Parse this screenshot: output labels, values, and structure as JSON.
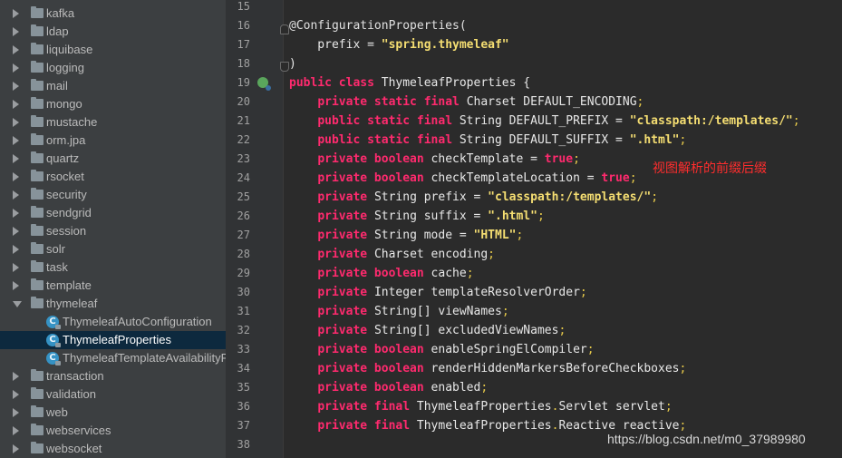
{
  "tree": {
    "items": [
      {
        "label": "kafka",
        "type": "folder",
        "expanded": false
      },
      {
        "label": "ldap",
        "type": "folder",
        "expanded": false
      },
      {
        "label": "liquibase",
        "type": "folder",
        "expanded": false
      },
      {
        "label": "logging",
        "type": "folder",
        "expanded": false
      },
      {
        "label": "mail",
        "type": "folder",
        "expanded": false
      },
      {
        "label": "mongo",
        "type": "folder",
        "expanded": false
      },
      {
        "label": "mustache",
        "type": "folder",
        "expanded": false
      },
      {
        "label": "orm.jpa",
        "type": "folder",
        "expanded": false
      },
      {
        "label": "quartz",
        "type": "folder",
        "expanded": false
      },
      {
        "label": "rsocket",
        "type": "folder",
        "expanded": false
      },
      {
        "label": "security",
        "type": "folder",
        "expanded": false
      },
      {
        "label": "sendgrid",
        "type": "folder",
        "expanded": false
      },
      {
        "label": "session",
        "type": "folder",
        "expanded": false
      },
      {
        "label": "solr",
        "type": "folder",
        "expanded": false
      },
      {
        "label": "task",
        "type": "folder",
        "expanded": false
      },
      {
        "label": "template",
        "type": "folder",
        "expanded": false
      },
      {
        "label": "thymeleaf",
        "type": "folder",
        "expanded": true
      },
      {
        "label": "ThymeleafAutoConfiguration",
        "type": "class",
        "icon_letter": "C"
      },
      {
        "label": "ThymeleafProperties",
        "type": "class",
        "icon_letter": "C",
        "selected": true
      },
      {
        "label": "ThymeleafTemplateAvailabilityProvider",
        "type": "class",
        "icon_letter": "C"
      },
      {
        "label": "transaction",
        "type": "folder",
        "expanded": false
      },
      {
        "label": "validation",
        "type": "folder",
        "expanded": false
      },
      {
        "label": "web",
        "type": "folder",
        "expanded": false
      },
      {
        "label": "webservices",
        "type": "folder",
        "expanded": false
      },
      {
        "label": "websocket",
        "type": "folder",
        "expanded": false
      }
    ]
  },
  "editor": {
    "line_numbers": [
      "15",
      "16",
      "17",
      "18",
      "19",
      "20",
      "21",
      "22",
      "23",
      "24",
      "25",
      "26",
      "27",
      "28",
      "29",
      "30",
      "31",
      "32",
      "33",
      "34",
      "35",
      "36",
      "37",
      "38"
    ],
    "lines": [
      [],
      [
        [
          "ann",
          "@ConfigurationProperties("
        ]
      ],
      [
        [
          "plain",
          "    prefix = "
        ],
        [
          "str",
          "\"spring.thymeleaf\""
        ]
      ],
      [
        [
          "plain",
          ")"
        ]
      ],
      [
        [
          "kw",
          "public class "
        ],
        [
          "plain",
          "ThymeleafProperties {"
        ]
      ],
      [
        [
          "plain",
          "    "
        ],
        [
          "kw",
          "private static final "
        ],
        [
          "plain",
          "Charset DEFAULT_ENCODING"
        ],
        [
          "pun",
          ";"
        ]
      ],
      [
        [
          "plain",
          "    "
        ],
        [
          "kw",
          "public static final "
        ],
        [
          "plain",
          "String DEFAULT_PREFIX = "
        ],
        [
          "str",
          "\"classpath:/templates/\""
        ],
        [
          "pun",
          ";"
        ]
      ],
      [
        [
          "plain",
          "    "
        ],
        [
          "kw",
          "public static final "
        ],
        [
          "plain",
          "String DEFAULT_SUFFIX = "
        ],
        [
          "str",
          "\".html\""
        ],
        [
          "pun",
          ";"
        ]
      ],
      [
        [
          "plain",
          "    "
        ],
        [
          "kw",
          "private boolean "
        ],
        [
          "plain",
          "checkTemplate = "
        ],
        [
          "kw",
          "true"
        ],
        [
          "pun",
          ";"
        ]
      ],
      [
        [
          "plain",
          "    "
        ],
        [
          "kw",
          "private boolean "
        ],
        [
          "plain",
          "checkTemplateLocation = "
        ],
        [
          "kw",
          "true"
        ],
        [
          "pun",
          ";"
        ]
      ],
      [
        [
          "plain",
          "    "
        ],
        [
          "kw",
          "private "
        ],
        [
          "plain",
          "String prefix = "
        ],
        [
          "str",
          "\"classpath:/templates/\""
        ],
        [
          "pun",
          ";"
        ]
      ],
      [
        [
          "plain",
          "    "
        ],
        [
          "kw",
          "private "
        ],
        [
          "plain",
          "String suffix = "
        ],
        [
          "str",
          "\".html\""
        ],
        [
          "pun",
          ";"
        ]
      ],
      [
        [
          "plain",
          "    "
        ],
        [
          "kw",
          "private "
        ],
        [
          "plain",
          "String mode = "
        ],
        [
          "str",
          "\"HTML\""
        ],
        [
          "pun",
          ";"
        ]
      ],
      [
        [
          "plain",
          "    "
        ],
        [
          "kw",
          "private "
        ],
        [
          "plain",
          "Charset encoding"
        ],
        [
          "pun",
          ";"
        ]
      ],
      [
        [
          "plain",
          "    "
        ],
        [
          "kw",
          "private boolean "
        ],
        [
          "plain",
          "cache"
        ],
        [
          "pun",
          ";"
        ]
      ],
      [
        [
          "plain",
          "    "
        ],
        [
          "kw",
          "private "
        ],
        [
          "plain",
          "Integer templateResolverOrder"
        ],
        [
          "pun",
          ";"
        ]
      ],
      [
        [
          "plain",
          "    "
        ],
        [
          "kw",
          "private "
        ],
        [
          "plain",
          "String[] viewNames"
        ],
        [
          "pun",
          ";"
        ]
      ],
      [
        [
          "plain",
          "    "
        ],
        [
          "kw",
          "private "
        ],
        [
          "plain",
          "String[] excludedViewNames"
        ],
        [
          "pun",
          ";"
        ]
      ],
      [
        [
          "plain",
          "    "
        ],
        [
          "kw",
          "private boolean "
        ],
        [
          "plain",
          "enableSpringElCompiler"
        ],
        [
          "pun",
          ";"
        ]
      ],
      [
        [
          "plain",
          "    "
        ],
        [
          "kw",
          "private boolean "
        ],
        [
          "plain",
          "renderHiddenMarkersBeforeCheckboxes"
        ],
        [
          "pun",
          ";"
        ]
      ],
      [
        [
          "plain",
          "    "
        ],
        [
          "kw",
          "private boolean "
        ],
        [
          "plain",
          "enabled"
        ],
        [
          "pun",
          ";"
        ]
      ],
      [
        [
          "plain",
          "    "
        ],
        [
          "kw",
          "private final "
        ],
        [
          "plain",
          "ThymeleafProperties"
        ],
        [
          "pun",
          "."
        ],
        [
          "plain",
          "Servlet servlet"
        ],
        [
          "pun",
          ";"
        ]
      ],
      [
        [
          "plain",
          "    "
        ],
        [
          "kw",
          "private final "
        ],
        [
          "plain",
          "ThymeleafProperties"
        ],
        [
          "pun",
          "."
        ],
        [
          "plain",
          "Reactive reactive"
        ],
        [
          "pun",
          ";"
        ]
      ],
      []
    ]
  },
  "annotation_text": "视图解析的前缀后缀",
  "watermark_text": "https://blog.csdn.net/m0_37989980",
  "colors": {
    "keyword": "#ff2a6e",
    "string": "#f5de72",
    "annotation_red": "#ff2d2d",
    "editor_bg": "#2b2b2b",
    "tree_bg": "#3c3f41",
    "selection": "#0d293e"
  }
}
